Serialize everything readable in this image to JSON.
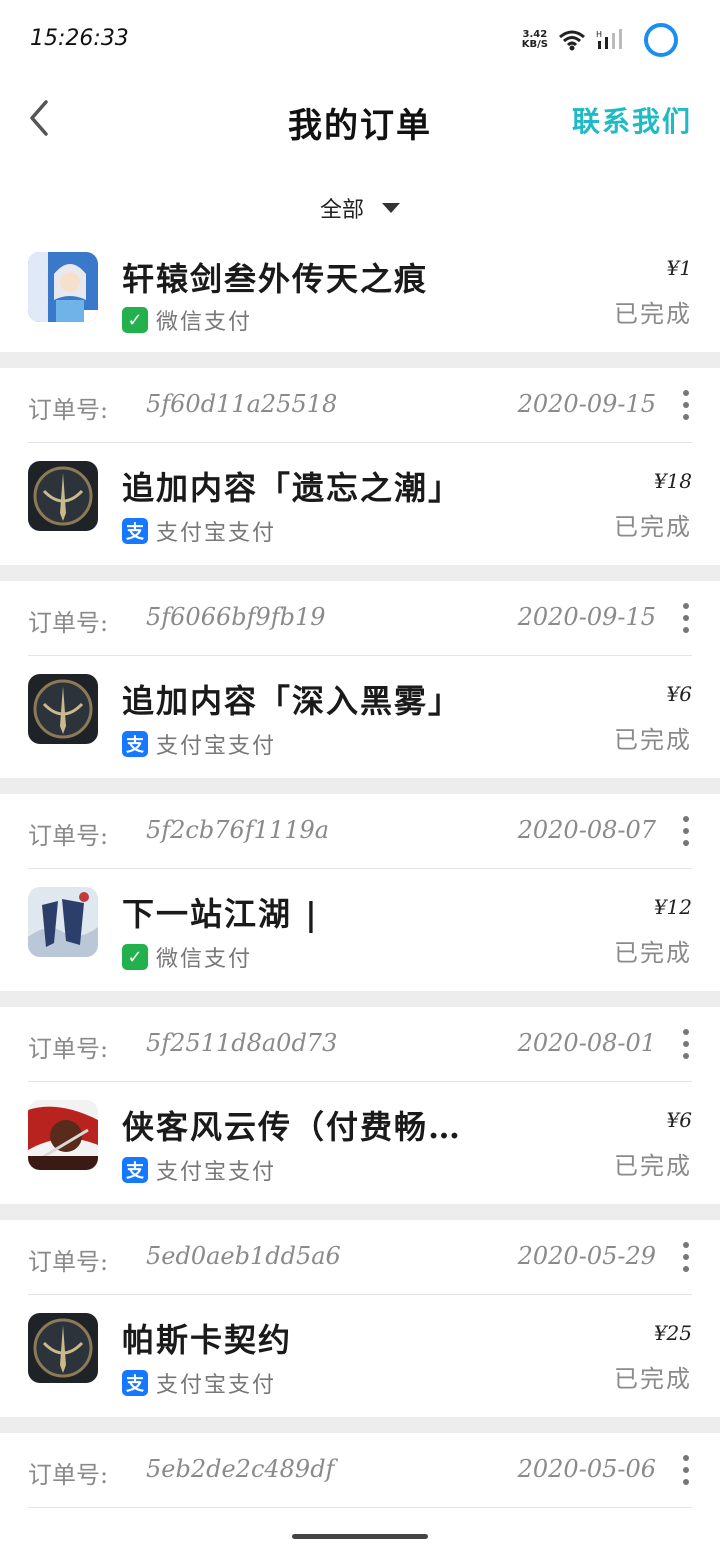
{
  "status_bar": {
    "time": "15:26:33",
    "net_speed_value": "3.42",
    "net_speed_unit": "KB/S",
    "icons": [
      "wifi-icon",
      "signal-icon",
      "circle-icon"
    ]
  },
  "header": {
    "title": "我的订单",
    "contact_label": "联系我们",
    "accent_color": "#1ebbc4"
  },
  "filter": {
    "selected": "全部"
  },
  "labels": {
    "order_prefix": "订单号:"
  },
  "first_item": {
    "game_name": "轩辕剑叁外传天之痕",
    "payment": "微信支付",
    "price": "¥1",
    "status": "已完成",
    "icon": "xuanyuan-game-icon"
  },
  "orders": [
    {
      "order_id": "5f60d11a25518",
      "date": "2020-09-15",
      "game_name": "追加内容「遗忘之潮」",
      "payment": "支付宝支付",
      "pay_type": "alipay",
      "price": "¥18",
      "status": "已完成",
      "icon": "dark-emblem-game-icon"
    },
    {
      "order_id": "5f6066bf9fb19",
      "date": "2020-09-15",
      "game_name": "追加内容「深入黑雾」",
      "payment": "支付宝支付",
      "pay_type": "alipay",
      "price": "¥6",
      "status": "已完成",
      "icon": "dark-emblem-game-icon"
    },
    {
      "order_id": "5f2cb76f1119a",
      "date": "2020-08-07",
      "game_name": "下一站江湖 |",
      "payment": "微信支付",
      "pay_type": "wechat",
      "price": "¥12",
      "status": "已完成",
      "icon": "xia-game-icon"
    },
    {
      "order_id": "5f2511d8a0d73",
      "date": "2020-08-01",
      "game_name": "侠客风云传（付费畅…",
      "payment": "支付宝支付",
      "pay_type": "alipay",
      "price": "¥6",
      "status": "已完成",
      "icon": "xiake-game-icon"
    },
    {
      "order_id": "5ed0aeb1dd5a6",
      "date": "2020-05-29",
      "game_name": "帕斯卡契约",
      "payment": "支付宝支付",
      "pay_type": "alipay",
      "price": "¥25",
      "status": "已完成",
      "icon": "dark-emblem-game-icon"
    }
  ],
  "last_order": {
    "order_id": "5eb2de2c489df",
    "date": "2020-05-06"
  },
  "pay_glyphs": {
    "alipay": "支",
    "wechat": "✓"
  }
}
